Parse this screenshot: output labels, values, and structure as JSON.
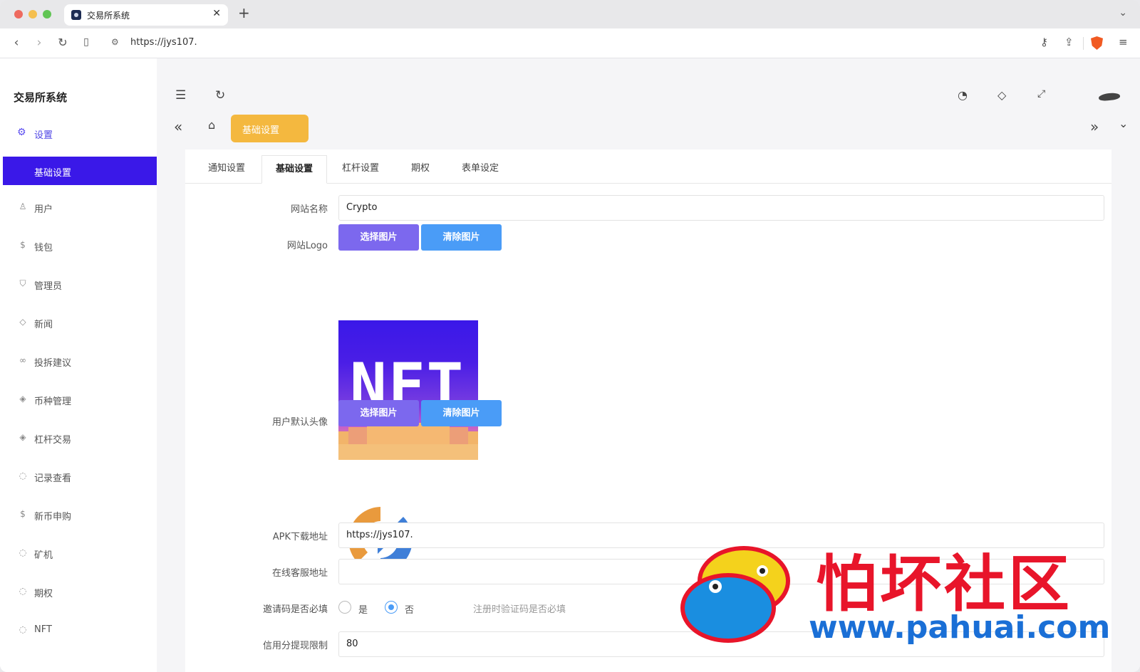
{
  "browser": {
    "tab_title": "交易所系统",
    "tab_close": "✕",
    "new_tab": "+",
    "url": "https://jys107."
  },
  "app": {
    "brand": "交易所系统",
    "sidebar": {
      "parent": {
        "label": "设置",
        "icon": "gear-icon"
      },
      "active_child": "基础设置",
      "items": [
        {
          "label": "用户",
          "icon": "user-icon"
        },
        {
          "label": "钱包",
          "icon": "dollar-icon"
        },
        {
          "label": "管理员",
          "icon": "shield-icon"
        },
        {
          "label": "新闻",
          "icon": "tag-icon"
        },
        {
          "label": "投拆建议",
          "icon": "link-icon"
        },
        {
          "label": "币种管理",
          "icon": "diamond-icon"
        },
        {
          "label": "杠杆交易",
          "icon": "diamond-icon"
        },
        {
          "label": "记录查看",
          "icon": "refresh-icon"
        },
        {
          "label": "新币申购",
          "icon": "dollar-icon"
        },
        {
          "label": "矿机",
          "icon": "refresh-icon"
        },
        {
          "label": "期权",
          "icon": "refresh-icon"
        },
        {
          "label": "NFT",
          "icon": "refresh-icon"
        }
      ]
    },
    "breadcrumb_tab": "基础设置",
    "page_tabs": [
      "通知设置",
      "基础设置",
      "杠杆设置",
      "期权",
      "表单设定"
    ],
    "active_page_tab": 1,
    "form": {
      "site_name_label": "网站名称",
      "site_name_value": "Crypto",
      "site_logo_label": "网站Logo",
      "select_image": "选择图片",
      "clear_image": "清除图片",
      "logo_text": "NFT",
      "avatar_label": "用户默认头像",
      "apk_label": "APK下载地址",
      "apk_value": "https://jys107.",
      "service_label": "在线客服地址",
      "service_value": "",
      "invite_label": "邀请码是否必填",
      "invite_yes": "是",
      "invite_no": "否",
      "invite_selected": "否",
      "invite_hint": "注册时验证码是否必填",
      "credit_label": "信用分提现限制",
      "credit_value": "80"
    }
  },
  "watermark": {
    "title": "怕坏社区",
    "url": "www.pahuai.com"
  },
  "colors": {
    "primary": "#3a18e8",
    "accent_tab": "#f4b83f",
    "button_purple": "#7c68ee",
    "button_blue": "#4a9cf7"
  }
}
